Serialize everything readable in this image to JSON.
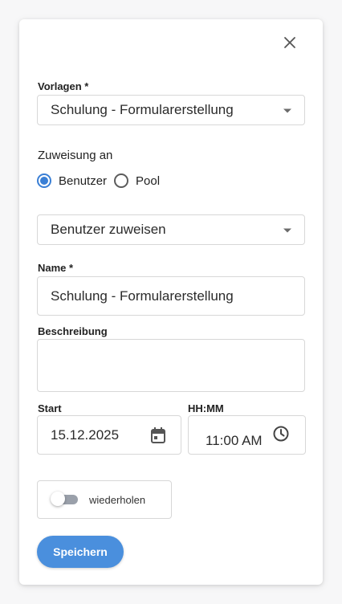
{
  "dialog": {
    "close_icon": "close-icon",
    "template": {
      "label": "Vorlagen *",
      "value": "Schulung - Formularerstellung"
    },
    "assignment": {
      "title": "Zuweisung an",
      "options": [
        {
          "label": "Benutzer",
          "selected": true
        },
        {
          "label": "Pool",
          "selected": false
        }
      ],
      "user_select_placeholder": "Benutzer zuweisen"
    },
    "name": {
      "label": "Name *",
      "value": "Schulung - Formularerstellung"
    },
    "description": {
      "label": "Beschreibung",
      "value": ""
    },
    "start": {
      "label": "Start",
      "value": "15.12.2025",
      "icon": "calendar-icon"
    },
    "time": {
      "label": "HH:MM",
      "value": "11:00 AM",
      "icon": "clock-icon"
    },
    "repeat": {
      "label": "wiederholen",
      "enabled": false
    },
    "save_label": "Speichern"
  },
  "colors": {
    "accent": "#4a8fdd",
    "radio_active": "#3a7fd5",
    "border": "#d7d7d7"
  }
}
